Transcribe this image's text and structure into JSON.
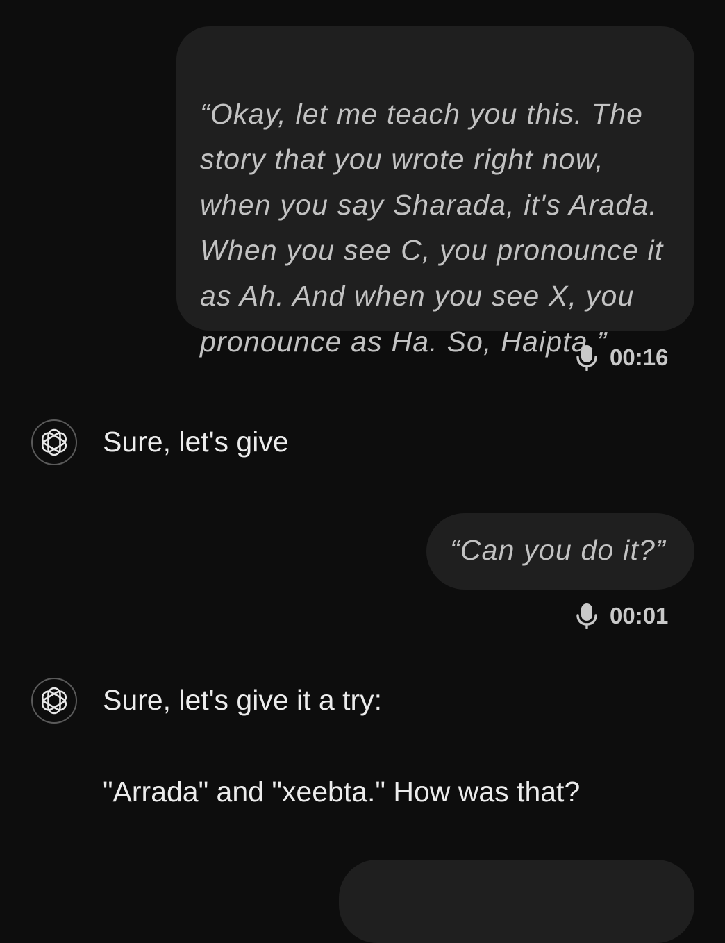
{
  "messages": [
    {
      "role": "user",
      "text": "“Okay, let me teach you this. The\nstory that you wrote right now,\nwhen you say Sharada, it's Arada.\nWhen you see C, you pronounce it\nas Ah. And when you see X, you\npronounce as Ha. So, Haipta.”",
      "duration": "00:16",
      "icon": "microphone-icon"
    },
    {
      "role": "assistant",
      "text": "Sure, let's give",
      "icon": "openai-logo-icon"
    },
    {
      "role": "user",
      "text": "“Can you do it?”",
      "duration": "00:01",
      "icon": "microphone-icon"
    },
    {
      "role": "assistant",
      "line1": "Sure, let's give it a try:",
      "line2": "\"Arrada\" and \"xeebta.\" How was that?",
      "icon": "openai-logo-icon"
    }
  ],
  "colors": {
    "background": "#0d0d0d",
    "user_bubble": "#1f1f1f",
    "user_text": "#c2c2c2",
    "assistant_text": "#ececec"
  }
}
